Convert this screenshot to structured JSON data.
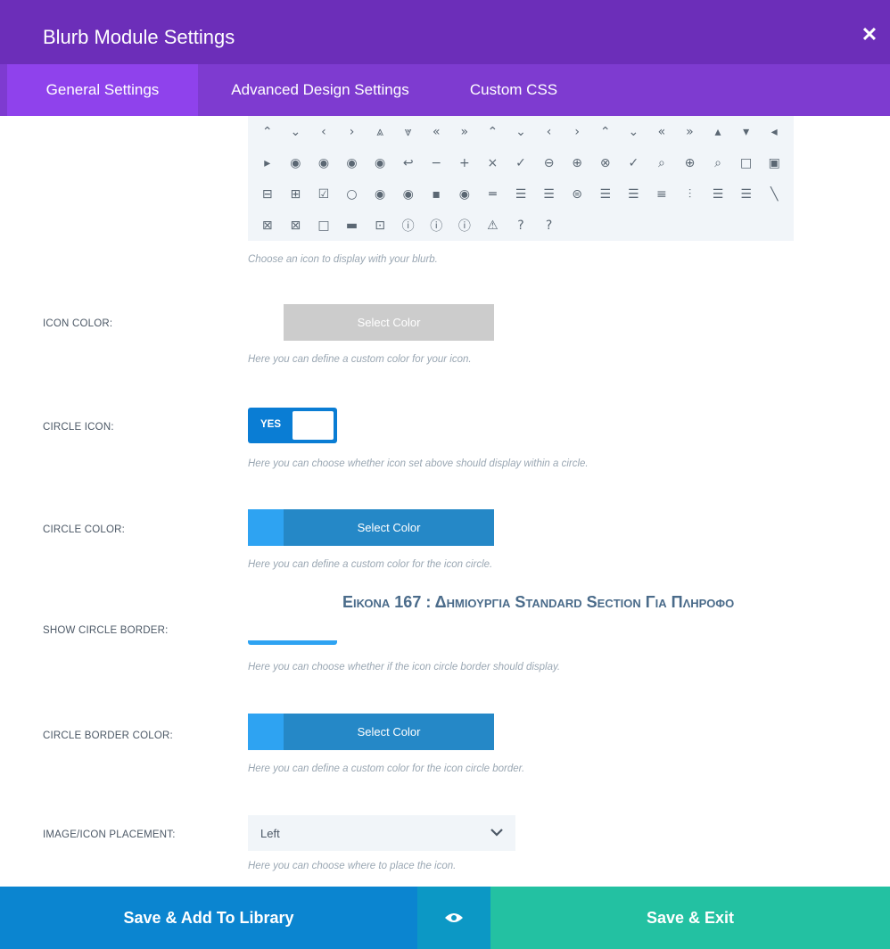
{
  "header": {
    "title": "Blurb Module Settings",
    "close_icon": "close-icon",
    "close_glyph": "✕"
  },
  "tabs": [
    {
      "label": "General Settings",
      "active": true
    },
    {
      "label": "Advanced Design Settings",
      "active": false
    },
    {
      "label": "Custom CSS",
      "active": false
    }
  ],
  "icon_picker": {
    "icons": [
      "⌃",
      "⌄",
      "‹",
      "›",
      "⩓",
      "⩔",
      "«",
      "»",
      "⌃",
      "⌄",
      "‹",
      "›",
      "⌃",
      "⌄",
      "«",
      "»",
      "▴",
      "▾",
      "◂",
      "▸",
      "◉",
      "◉",
      "◉",
      "◉",
      "↩",
      "−",
      "+",
      "×",
      "✓",
      "⊖",
      "⊕",
      "⊗",
      "✓",
      "⌕",
      "⊕",
      "⌕",
      "□",
      "▣",
      "⊟",
      "⊞",
      "☑",
      "○",
      "◉",
      "◉",
      "▪",
      "◉",
      "═",
      "☰",
      "☰",
      "⊜",
      "☰",
      "☰",
      "≡",
      "⫶",
      "☰",
      "☰",
      "╲",
      "⊠",
      "⊠",
      "□",
      "▬",
      "⊡",
      "ⓘ",
      "ⓘ",
      "ⓘ",
      "⚠",
      "?",
      "?"
    ],
    "help": "Choose an icon to display with your blurb."
  },
  "icon_color": {
    "label": "ICON COLOR:",
    "button": "Select Color",
    "help": "Here you can define a custom color for your icon.",
    "swatch_color": "#ffffff"
  },
  "circle_icon": {
    "label": "CIRCLE ICON:",
    "toggle": "YES",
    "help": "Here you can choose whether icon set above should display within a circle."
  },
  "circle_color": {
    "label": "CIRCLE COLOR:",
    "button": "Select Color",
    "help": "Here you can define a custom color for the icon circle.",
    "swatch_color": "#2ea3f2"
  },
  "show_circle_border": {
    "label": "SHOW CIRCLE BORDER:",
    "help": "Here you can choose whether if the icon circle border should display."
  },
  "overlay_caption": "Εικονα 167 : Δημιουργια Standard Section Για Πληροφο",
  "circle_border_color": {
    "label": "CIRCLE BORDER COLOR:",
    "button": "Select Color",
    "help": "Here you can define a custom color for the icon circle border.",
    "swatch_color": "#2ea3f2"
  },
  "placement": {
    "label": "IMAGE/ICON PLACEMENT:",
    "value": "Left",
    "help": "Here you can choose where to place the icon.",
    "icon": "chevron-down-icon"
  },
  "footer": {
    "library_label": "Save & Add To Library",
    "preview_icon": "eye-icon",
    "exit_label": "Save & Exit"
  },
  "colors": {
    "header": "#6c2eb9",
    "tabs": "#7e3bd0",
    "primary_blue": "#2588c7",
    "exit_green": "#23c1a2"
  }
}
